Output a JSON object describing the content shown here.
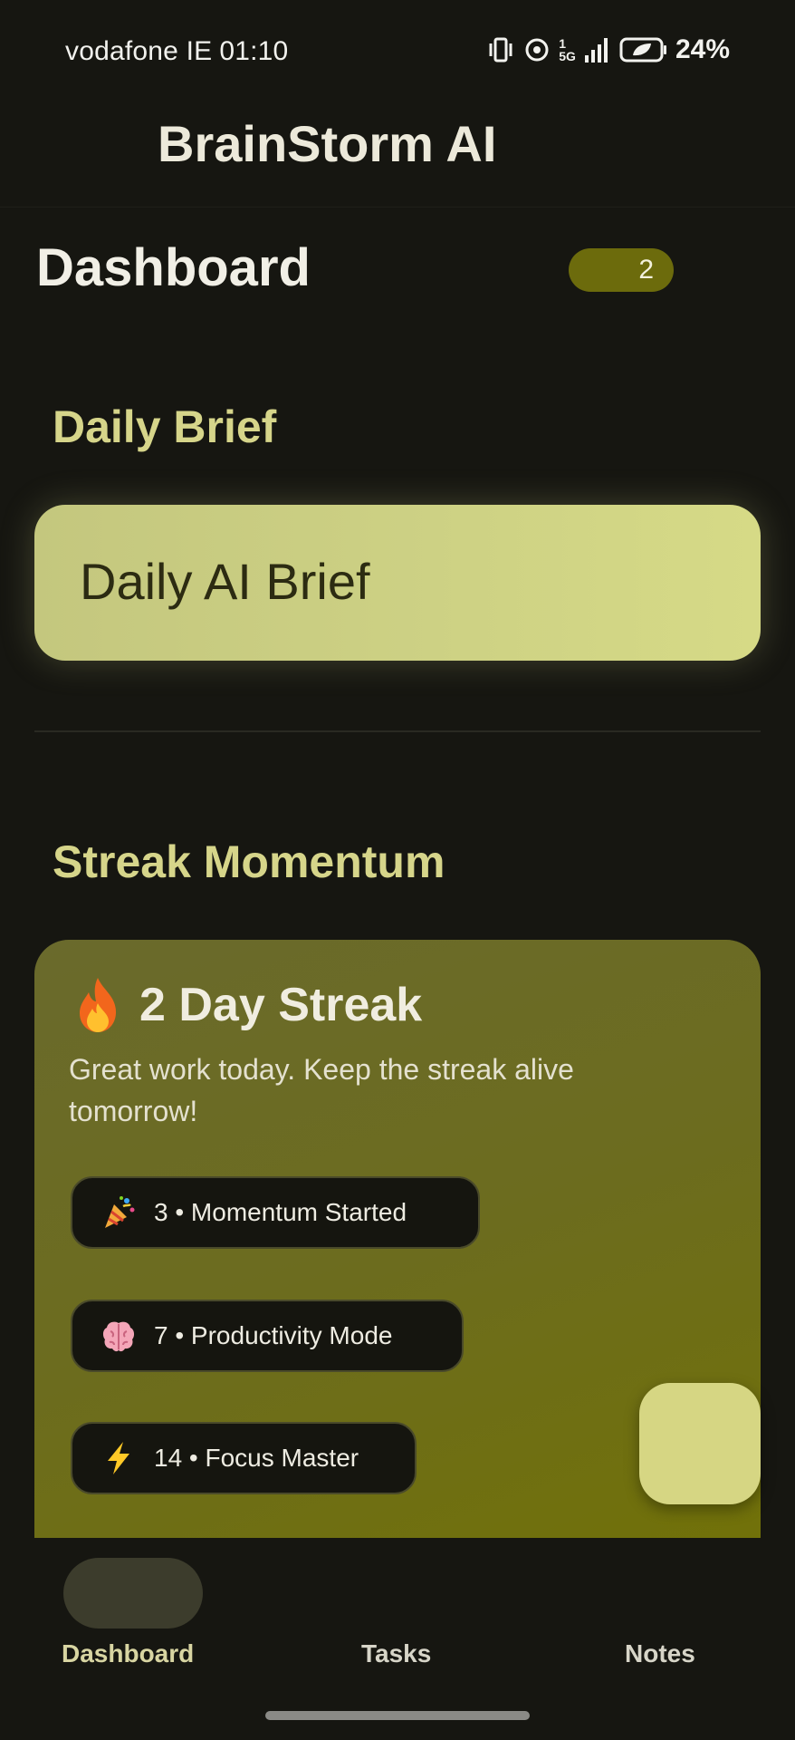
{
  "status_bar": {
    "carrier": "vodafone IE",
    "time": "01:10",
    "network_label": "5G",
    "sim_label": "1",
    "battery": "24%"
  },
  "app": {
    "title": "BrainStorm AI"
  },
  "header": {
    "title": "Dashboard",
    "badge_count": "2"
  },
  "daily_brief": {
    "heading": "Daily Brief",
    "card_title": "Daily AI Brief"
  },
  "streak": {
    "heading": "Streak Momentum",
    "title": "2 Day Streak",
    "subtitle": "Great work today. Keep the streak alive tomorrow!",
    "milestones": [
      {
        "icon": "party-popper-icon",
        "label": "3 • Momentum Started"
      },
      {
        "icon": "brain-icon",
        "label": "7 • Productivity Mode"
      },
      {
        "icon": "lightning-icon",
        "label": "14 • Focus Master"
      }
    ]
  },
  "bottom_nav": {
    "items": [
      {
        "label": "Dashboard",
        "active": true
      },
      {
        "label": "Tasks",
        "active": false
      },
      {
        "label": "Notes",
        "active": false
      }
    ]
  },
  "colors": {
    "background": "#161611",
    "accent": "#d6d583",
    "streak_card": "#6c6c1f",
    "badge": "#6c6b0c"
  }
}
